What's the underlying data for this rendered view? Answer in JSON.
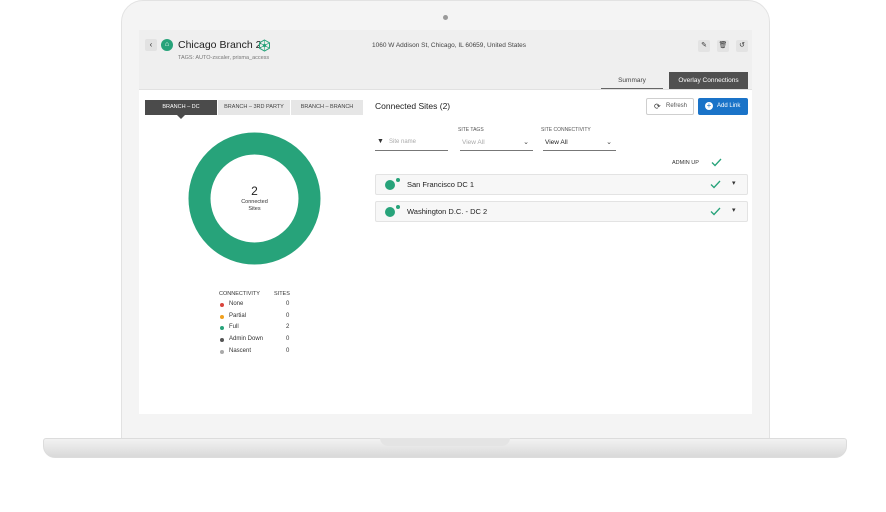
{
  "site": {
    "name": "Chicago Branch 2",
    "tags_line": "TAGS: AUTO-zscaler, prisma_access",
    "address": "1060 W Addison St, Chicago, IL 60659, United States"
  },
  "header_buttons": {
    "back_icon": "chevron-left-icon",
    "edit_icon": "pencil-icon",
    "delete_icon": "trash-icon",
    "history_icon": "history-icon"
  },
  "tabs": [
    {
      "label": "Summary",
      "active": false
    },
    {
      "label": "Overlay Connections",
      "active": true
    }
  ],
  "segments": [
    {
      "label": "BRANCH – DC",
      "active": true
    },
    {
      "label": "BRANCH – 3RD PARTY",
      "active": false
    },
    {
      "label": "BRANCH – BRANCH",
      "active": false
    }
  ],
  "donut": {
    "count": "2",
    "label_line1": "Connected",
    "label_line2": "Sites",
    "color": "#27a37a",
    "fraction": 1.0
  },
  "legend": {
    "header_connectivity": "CONNECTIVITY",
    "header_sites": "SITES",
    "rows": [
      {
        "label": "None",
        "count": "0",
        "color": "#d9453d"
      },
      {
        "label": "Partial",
        "count": "0",
        "color": "#f0a01e"
      },
      {
        "label": "Full",
        "count": "2",
        "color": "#27a37a"
      },
      {
        "label": "Admin Down",
        "count": "0",
        "color": "#555555"
      },
      {
        "label": "Nascent",
        "count": "0",
        "color": "#aaaaaa"
      }
    ]
  },
  "main": {
    "title": "Connected Sites (2)",
    "refresh_label": "Refresh",
    "add_link_label": "Add Link",
    "search_placeholder": "Site name",
    "site_tags_label": "SITE TAGS",
    "site_tags_value": "View All",
    "site_connectivity_label": "SITE CONNECTIVITY",
    "site_connectivity_value": "View All",
    "admin_up_label": "ADMIN UP",
    "admin_up_checked": true
  },
  "sites": [
    {
      "name": "San Francisco DC 1",
      "admin_up": true
    },
    {
      "name": "Washington D.C. - DC 2",
      "admin_up": true
    }
  ],
  "colors": {
    "accent_blue": "#1a73c8",
    "brand_green": "#27a37a",
    "active_tab": "#505050"
  }
}
